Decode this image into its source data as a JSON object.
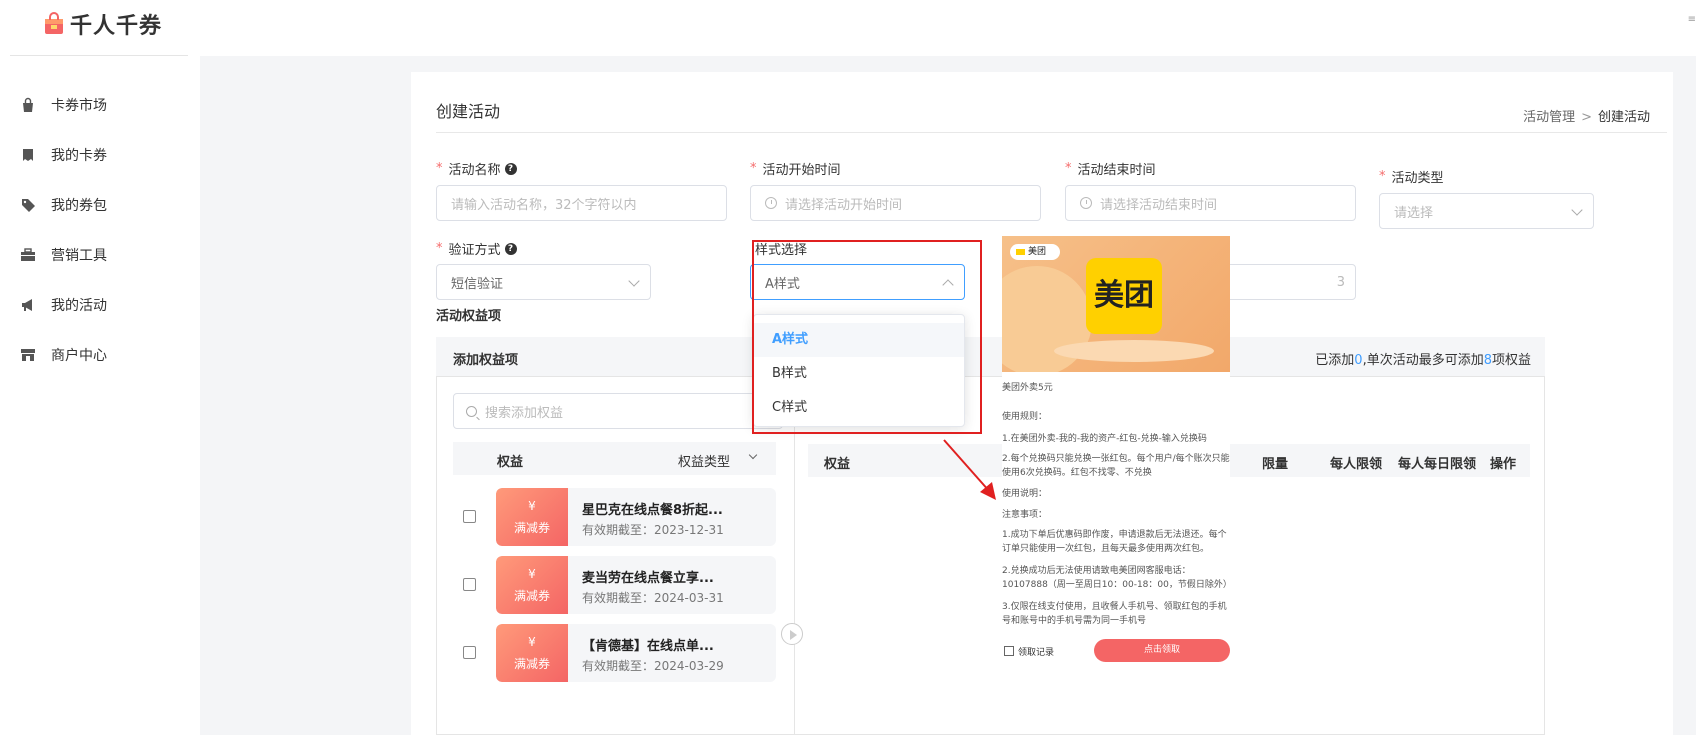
{
  "app": {
    "name": "千人千券"
  },
  "sidebar": {
    "items": [
      {
        "label": "卡券市场",
        "icon": "bag-icon"
      },
      {
        "label": "我的卡券",
        "icon": "ticket-icon"
      },
      {
        "label": "我的券包",
        "icon": "tag-icon"
      },
      {
        "label": "营销工具",
        "icon": "briefcase-icon"
      },
      {
        "label": "我的活动",
        "icon": "megaphone-icon"
      },
      {
        "label": "商户中心",
        "icon": "store-icon"
      }
    ]
  },
  "page": {
    "title": "创建活动",
    "breadcrumb": {
      "parent": "活动管理",
      "separator": ">",
      "current": "创建活动"
    }
  },
  "form": {
    "activity_name": {
      "label": "活动名称",
      "placeholder": "请输入活动名称，32个字符以内"
    },
    "start_time": {
      "label": "活动开始时间",
      "placeholder": "请选择活动开始时间"
    },
    "end_time": {
      "label": "活动结束时间",
      "placeholder": "请选择活动结束时间"
    },
    "activity_type": {
      "label": "活动类型",
      "placeholder": "请选择"
    },
    "verify_method": {
      "label": "验证方式",
      "value": "短信验证"
    },
    "style_select": {
      "label": "样式选择",
      "value": "A样式",
      "options": [
        "A样式",
        "B样式",
        "C样式"
      ]
    },
    "hidden_input_fragment": "3"
  },
  "benefits": {
    "section_title": "活动权益项",
    "panel_title": "添加权益项",
    "info": {
      "prefix": "已添加",
      "count": "0",
      "mid": ",单次活动最多可添加",
      "max": "8",
      "suffix": "项权益"
    },
    "search_placeholder": "搜索添加权益",
    "left_headers": {
      "benefit": "权益",
      "type": "权益类型"
    },
    "right_headers": {
      "benefit": "权益",
      "limit": "限量",
      "per_person": "每人限领",
      "per_person_daily": "每人每日限领",
      "action": "操作"
    },
    "coupons": [
      {
        "yen": "¥",
        "type": "满减券",
        "name": "星巴克在线点餐8折起...",
        "expiry": "有效期截至：2023-12-31"
      },
      {
        "yen": "¥",
        "type": "满减券",
        "name": "麦当劳在线点餐立享...",
        "expiry": "有效期截至：2024-03-31"
      },
      {
        "yen": "¥",
        "type": "满减券",
        "name": "【肯德基】在线点单...",
        "expiry": "有效期截至：2024-03-29"
      }
    ]
  },
  "preview": {
    "brand_tag": "美团",
    "brand_logo": "美团",
    "title": "美团外卖5元",
    "lines": [
      "使用规则：",
      "1.在美团外卖-我的-我的资产-红包-兑换-输入兑换码",
      "2.每个兑换码只能兑换一张红包。每个用户/每个账次只能使用6次兑换码。红包不找零、不兑换",
      "使用说明：",
      "注意事项：",
      "1.成功下单后优惠码即作废，申请退款后无法退还。每个订单只能使用一次红包，且每天最多使用两次红包。",
      "2.兑换成功后无法使用请致电美团网客服电话：10107888（周一至周日10：00-18：00，节假日除外）",
      "3.仅限在线支付使用，且收餐人手机号、领取红包的手机号和账号中的手机号需为同一手机号"
    ],
    "record_label": "领取记录",
    "claim_button": "点击领取"
  },
  "colors": {
    "accent": "#409eff",
    "required": "#f56c6c",
    "coupon": "#f46565",
    "annotation": "#e02020",
    "meituan": "#ffd000"
  }
}
